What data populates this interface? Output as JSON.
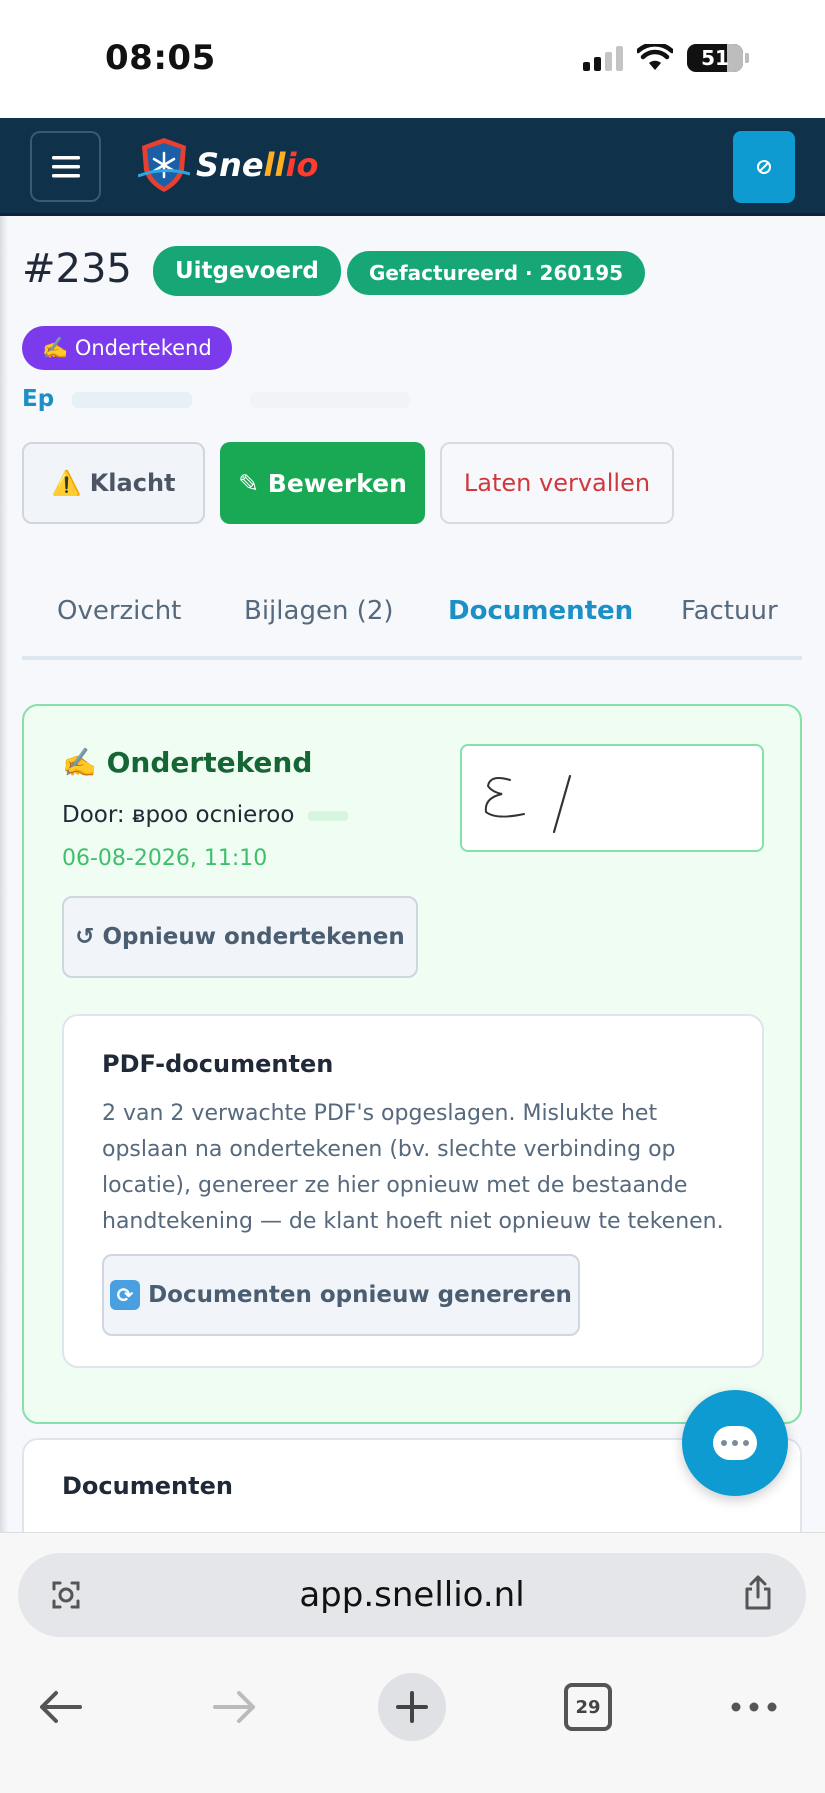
{
  "status_bar": {
    "time": "08:05",
    "battery": "51"
  },
  "app_header": {
    "logo_text_1": "Sne",
    "logo_text_2": "ll",
    "logo_text_3": "io"
  },
  "job": {
    "number": "#235",
    "status_badge": "Uitgevoerd",
    "invoice_badge": "Gefactureerd · 260195",
    "signed_badge": "✍️ Ondertekend",
    "customer_prefix": "Ep"
  },
  "actions": {
    "klacht": "⚠️ Klacht",
    "edit": "✎ Bewerken",
    "expire": "Laten vervallen"
  },
  "tabs": [
    {
      "label": "Overzicht"
    },
    {
      "label": "Bijlagen (2)"
    },
    {
      "label": "Documenten"
    },
    {
      "label": "Factuur"
    }
  ],
  "signed_panel": {
    "title": "✍️ Ondertekend",
    "by_label": "Door:",
    "by_value": "ᴃpoo ocnieroo",
    "date": "06-08-2026, 11:10",
    "resign_button": "↺ Opnieuw ondertekenen"
  },
  "pdf_card": {
    "title": "PDF-documenten",
    "description": "2 van 2 verwachte PDF's opgeslagen. Mislukte het opslaan na ondertekenen (bv. slechte verbinding op locatie), genereer ze hier opnieuw met de bestaande handtekening — de klant hoeft niet opnieuw te tekenen.",
    "regen_button": "Documenten opnieuw genereren"
  },
  "documents_card": {
    "title": "Documenten"
  },
  "browser": {
    "url": "app.snellio.nl",
    "tab_count": "29"
  },
  "colors": {
    "header_bg": "#10314a",
    "accent_blue": "#0e9bd1",
    "success_green": "#17a776",
    "signed_purple": "#7c3aed",
    "danger_red": "#d0383f"
  }
}
